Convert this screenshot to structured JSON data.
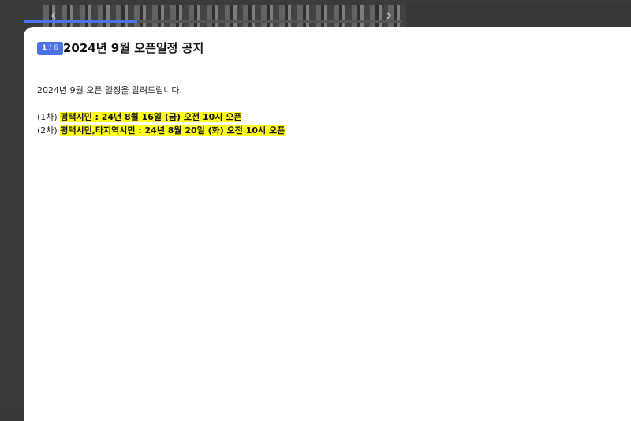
{
  "background": {
    "prev_icon": "‹",
    "next_icon": "›",
    "progress_fraction": 0.3
  },
  "notice": {
    "counter": {
      "current": "1",
      "separator": "/",
      "total": "6"
    },
    "title": "2024년 9월 오픈일정 공지",
    "intro": "2024년 9월 오픈 일정을 알려드립니다.",
    "schedule": [
      {
        "prefix": "(1차) ",
        "highlight": "평택시민 :  24년 8월 16일 (금) 오전 10시 오픈"
      },
      {
        "prefix": "(2차) ",
        "highlight": "평택시민,타지역시민 : 24년 8월 20일 (화) 오전 10시 오픈"
      }
    ]
  },
  "colors": {
    "accent": "#4c72e6",
    "highlight": "#ffff1a",
    "progress": "#4a74e8"
  }
}
